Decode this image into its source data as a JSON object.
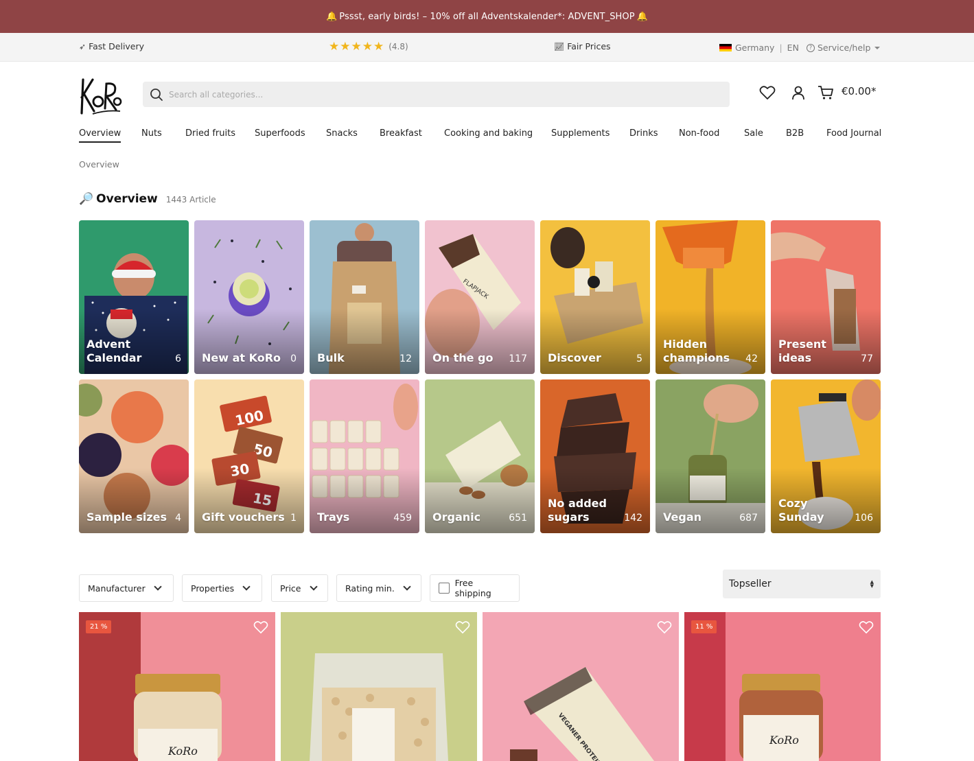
{
  "promo": {
    "text": "Pssst, early birds! – 10% off all Adventskalender*: ADVENT_SHOP"
  },
  "usp": {
    "fast_delivery": "Fast Delivery",
    "stars": "★★★★★",
    "rating": "(4.8)",
    "fair_prices": "Fair Prices",
    "country": "Germany",
    "language": "EN",
    "service": "Service/help"
  },
  "header": {
    "logo_text": "KoRo",
    "search_placeholder": "Search all categories...",
    "cart_total": "€0.00*"
  },
  "nav": [
    "Overview",
    "Nuts",
    "Dried fruits",
    "Superfoods",
    "Snacks",
    "Breakfast",
    "Cooking and baking",
    "Supplements",
    "Drinks",
    "Non-food",
    "Sale",
    "B2B",
    "Food Journal"
  ],
  "breadcrumb": "Overview",
  "heading": {
    "title": "Overview",
    "count": "1443 Article"
  },
  "categories": [
    {
      "name": "Advent Calendar",
      "count": "6"
    },
    {
      "name": "New at KoRo",
      "count": "0"
    },
    {
      "name": "Bulk",
      "count": "12"
    },
    {
      "name": "On the go",
      "count": "117"
    },
    {
      "name": "Discover",
      "count": "5"
    },
    {
      "name": "Hidden champions",
      "count": "42"
    },
    {
      "name": "Present ideas",
      "count": "77"
    },
    {
      "name": "Sample sizes",
      "count": "4"
    },
    {
      "name": "Gift vouchers",
      "count": "1"
    },
    {
      "name": "Trays",
      "count": "459"
    },
    {
      "name": "Organic",
      "count": "651"
    },
    {
      "name": "No added sugars",
      "count": "142"
    },
    {
      "name": "Vegan",
      "count": "687"
    },
    {
      "name": "Cozy Sunday",
      "count": "106"
    }
  ],
  "filters": {
    "manufacturer": "Manufacturer",
    "properties": "Properties",
    "price": "Price",
    "rating": "Rating min.",
    "free_shipping": "Free shipping"
  },
  "sort": {
    "selected": "Topseller"
  },
  "products": [
    {
      "badge": "21 %"
    },
    {
      "badge": ""
    },
    {
      "badge": ""
    },
    {
      "badge": "11 %"
    }
  ]
}
